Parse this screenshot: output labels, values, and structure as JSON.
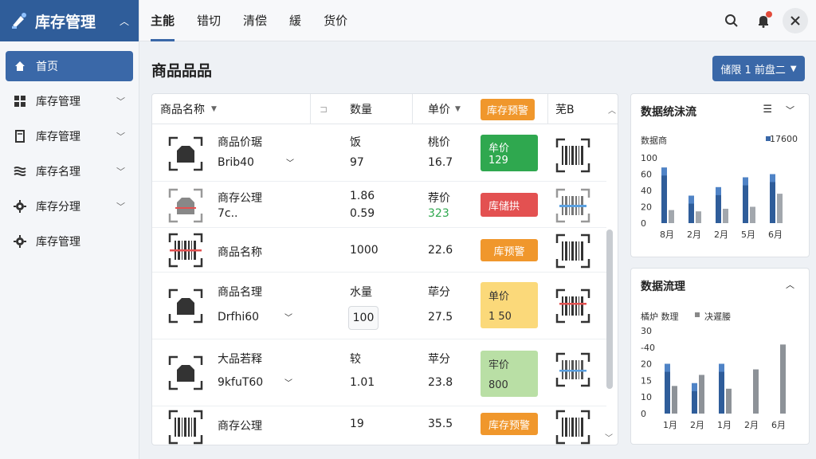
{
  "sidebar": {
    "title": "库存管理",
    "items": [
      {
        "label": "首页",
        "icon": "home-icon"
      },
      {
        "label": "库存管理",
        "icon": "grid-icon"
      },
      {
        "label": "库存管理",
        "icon": "document-icon"
      },
      {
        "label": "库存名理",
        "icon": "layers-icon"
      },
      {
        "label": "库存分理",
        "icon": "gear-icon"
      },
      {
        "label": "库存管理",
        "icon": "gear-icon"
      }
    ]
  },
  "tabs": [
    "主能",
    "错切",
    "清偿",
    "緩",
    "货价"
  ],
  "page_title": "商品品品",
  "top_action": "储限 1  前盘二",
  "table": {
    "headers": {
      "name": "商品名称",
      "qty": "数量",
      "price": "单价",
      "alert": "库存预警",
      "code": "芜B"
    },
    "rows": [
      {
        "name1": "商品价琚",
        "name2": "Brib40",
        "q1": "饭",
        "q2": "97",
        "p1": "桃价",
        "p2": "16.7",
        "s1": "牟价",
        "s2": "129"
      },
      {
        "name1": "商存公理",
        "name2": "7c..",
        "q1": "1.86",
        "q2": "0.59",
        "p1": "荐价",
        "p2": "323",
        "s1": "库储拱",
        "s2": ""
      },
      {
        "name1": "商品名称",
        "name2": "",
        "q1": "1000",
        "q2": "",
        "p1": "22.6",
        "p2": "",
        "s1": "库预警",
        "s2": ""
      },
      {
        "name1": "商品名理",
        "name2": "Drfhi60",
        "q1": "水量",
        "q2": "100",
        "p1": "荜分",
        "p2": "27.5",
        "s1": "单价",
        "s2": "1 50"
      },
      {
        "name1": "大品若释",
        "name2": "9kfuT60",
        "q1": "较",
        "q2": "1.01",
        "p1": "苹分",
        "p2": "23.8",
        "s1": "牢价",
        "s2": "800"
      },
      {
        "name1": "商存公理",
        "name2": "",
        "q1": "19",
        "q2": "",
        "p1": "35.5",
        "p2": "",
        "s1": "库存预警",
        "s2": ""
      }
    ]
  },
  "panel1": {
    "title": "数据统沬流",
    "legend_left": "数据商",
    "legend_right": "17600"
  },
  "panel2": {
    "title": "数据流理",
    "legend_a": "橘炉 数理",
    "legend_b": "决遲媵"
  },
  "chart_data": [
    {
      "type": "bar",
      "categories": [
        "8月",
        "2月",
        "2月",
        "5月",
        "6月"
      ],
      "ylim": [
        0,
        100
      ],
      "yticks": [
        "100",
        "60",
        "40",
        "20",
        "0"
      ],
      "series": [
        {
          "name": "17600",
          "values": [
            85,
            42,
            55,
            70,
            75
          ]
        },
        {
          "values": [
            20,
            18,
            22,
            25,
            45
          ]
        }
      ]
    },
    {
      "type": "bar",
      "categories": [
        "1月",
        "2月",
        "1月",
        "2月",
        "6月"
      ],
      "ylim": [
        0,
        30
      ],
      "yticks": [
        "30",
        "-40",
        "20",
        "15",
        "10",
        "0"
      ],
      "series": [
        {
          "name": "橘炉 数理",
          "values": [
            18,
            11,
            18,
            0,
            0
          ]
        },
        {
          "name": "决遲媵",
          "values": [
            10,
            14,
            9,
            16,
            25
          ]
        }
      ]
    }
  ],
  "colors": {
    "primary": "#3a68a8",
    "alert_orange": "#f0972c",
    "green": "#2fa84f",
    "red": "#e35151"
  }
}
